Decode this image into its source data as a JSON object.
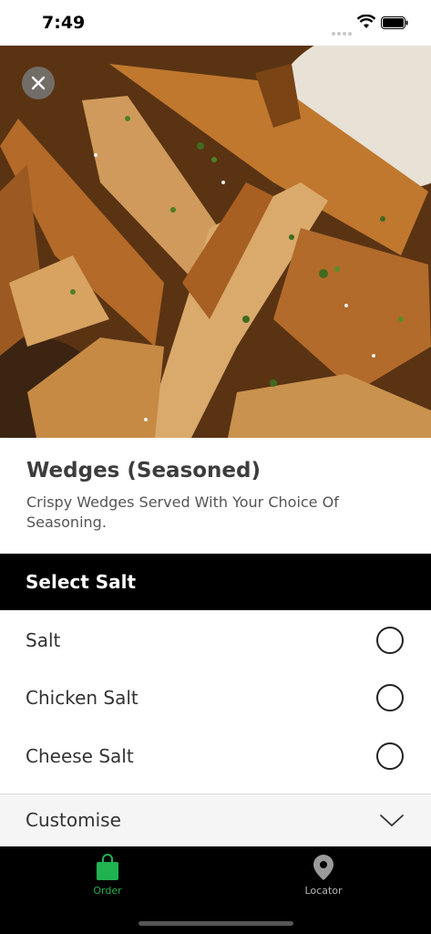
{
  "status_bar": {
    "time": "7:49"
  },
  "product": {
    "title": "Wedges (Seasoned)",
    "description": "Crispy Wedges Served With Your Choice Of Seasoning."
  },
  "section": {
    "title": "Select Salt"
  },
  "options": [
    {
      "label": "Salt",
      "selected": false
    },
    {
      "label": "Chicken Salt",
      "selected": false
    },
    {
      "label": "Cheese Salt",
      "selected": false
    }
  ],
  "customise": {
    "label": "Customise"
  },
  "tabs": [
    {
      "label": "Order",
      "icon": "shopping-bag-icon",
      "active": true
    },
    {
      "label": "Locator",
      "icon": "map-pin-icon",
      "active": false
    }
  ],
  "colors": {
    "accent": "#1fb24f",
    "header_bg": "#000000",
    "tab_inactive": "#b5b5b5"
  }
}
